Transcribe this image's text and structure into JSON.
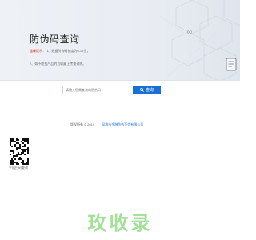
{
  "header": {
    "title": "防伪码查询",
    "hint_label": "温馨提示：",
    "hint_1": "1、数据防伪码长度为6-12位；",
    "hint_2": "2、如不能找产品的为收藏上传查询线。"
  },
  "search": {
    "placeholder": "请输入您需查询的防伪码",
    "button_label": "查询",
    "button_color": "#1a6fd6"
  },
  "footer": {
    "copyright": "版权所有 © 2019",
    "company_link": "深圳市金融防伪互信有限公司"
  },
  "qr": {
    "caption": "手机扫码查询"
  },
  "watermark": {
    "text": "玫收录"
  },
  "colors": {
    "accent": "#1a6fd6",
    "hint_red": "#d9352b",
    "watermark_green": "#a4e09a"
  }
}
